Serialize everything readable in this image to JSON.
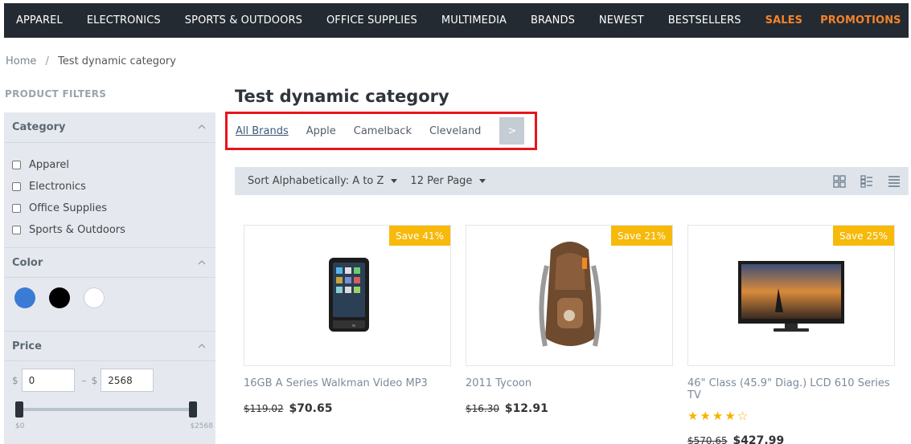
{
  "nav": {
    "items": [
      "APPAREL",
      "ELECTRONICS",
      "SPORTS & OUTDOORS",
      "OFFICE SUPPLIES",
      "MULTIMEDIA",
      "BRANDS",
      "NEWEST",
      "BESTSELLERS"
    ],
    "sales": "SALES",
    "promotions": "PROMOTIONS"
  },
  "breadcrumb": {
    "home": "Home",
    "separator": "/",
    "current": "Test dynamic category"
  },
  "filters": {
    "title": "PRODUCT FILTERS",
    "category": {
      "label": "Category",
      "items": [
        "Apparel",
        "Electronics",
        "Office Supplies",
        "Sports & Outdoors"
      ]
    },
    "color": {
      "label": "Color",
      "swatches": [
        "#3a7bd5",
        "#000000",
        "#ffffff"
      ]
    },
    "price": {
      "label": "Price",
      "currency": "$",
      "dash": "–",
      "min": "0",
      "max": "2568",
      "range_min_label": "$0",
      "range_max_label": "$2568",
      "handle_min": 0,
      "handle_max": 1
    }
  },
  "page": {
    "title": "Test dynamic category"
  },
  "brands": {
    "items": [
      "All Brands",
      "Apple",
      "Camelback",
      "Cleveland"
    ],
    "next": ">"
  },
  "toolbar": {
    "sort": "Sort Alphabetically: A to Z",
    "per_page": "12 Per Page"
  },
  "products": [
    {
      "badge": "Save 41%",
      "name": "16GB A Series Walkman Video MP3",
      "old_price": "$119.02",
      "price": "$70.65",
      "rating": null
    },
    {
      "badge": "Save 21%",
      "name": "2011 Tycoon",
      "old_price": "$16.30",
      "price": "$12.91",
      "rating": null
    },
    {
      "badge": "Save 25%",
      "name": "46\" Class (45.9\" Diag.) LCD 610 Series TV",
      "old_price": "$570.65",
      "price": "$427.99",
      "rating": 4
    }
  ],
  "colors": {
    "accent": "#f5822a",
    "nav_bg": "#232a31",
    "badge": "#f7b90a",
    "highlight_border": "#e8141c"
  }
}
